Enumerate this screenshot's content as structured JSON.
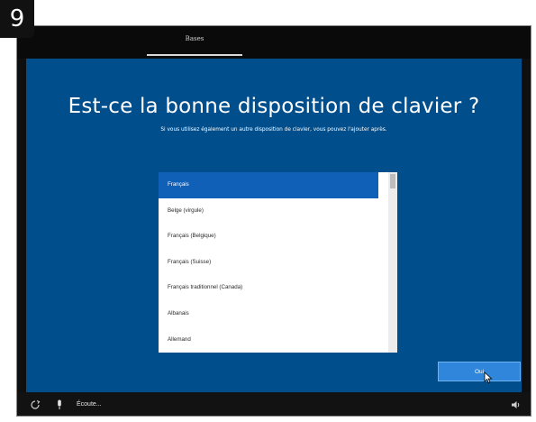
{
  "step_badge": "9",
  "top_bar": {
    "tab_label": "Bases"
  },
  "main": {
    "title": "Est-ce la bonne disposition de clavier ?",
    "subtitle": "Si vous utilisez également un autre disposition de clavier, vous pouvez l'ajouter après.",
    "layouts": [
      "Français",
      "Belge (virgule)",
      "Français (Belgique)",
      "Français (Suisse)",
      "Français traditionnel (Canada)",
      "Albanais",
      "Allemand"
    ],
    "selected_index": 0,
    "confirm_button": "Oui"
  },
  "bottom_bar": {
    "listening_label": "Écoute...",
    "icons": [
      "accessibility-icon",
      "microphone-icon",
      "volume-icon"
    ]
  },
  "colors": {
    "main_bg": "#004e8c",
    "selected_bg": "#1060b8",
    "button_bg": "#2f86db"
  }
}
